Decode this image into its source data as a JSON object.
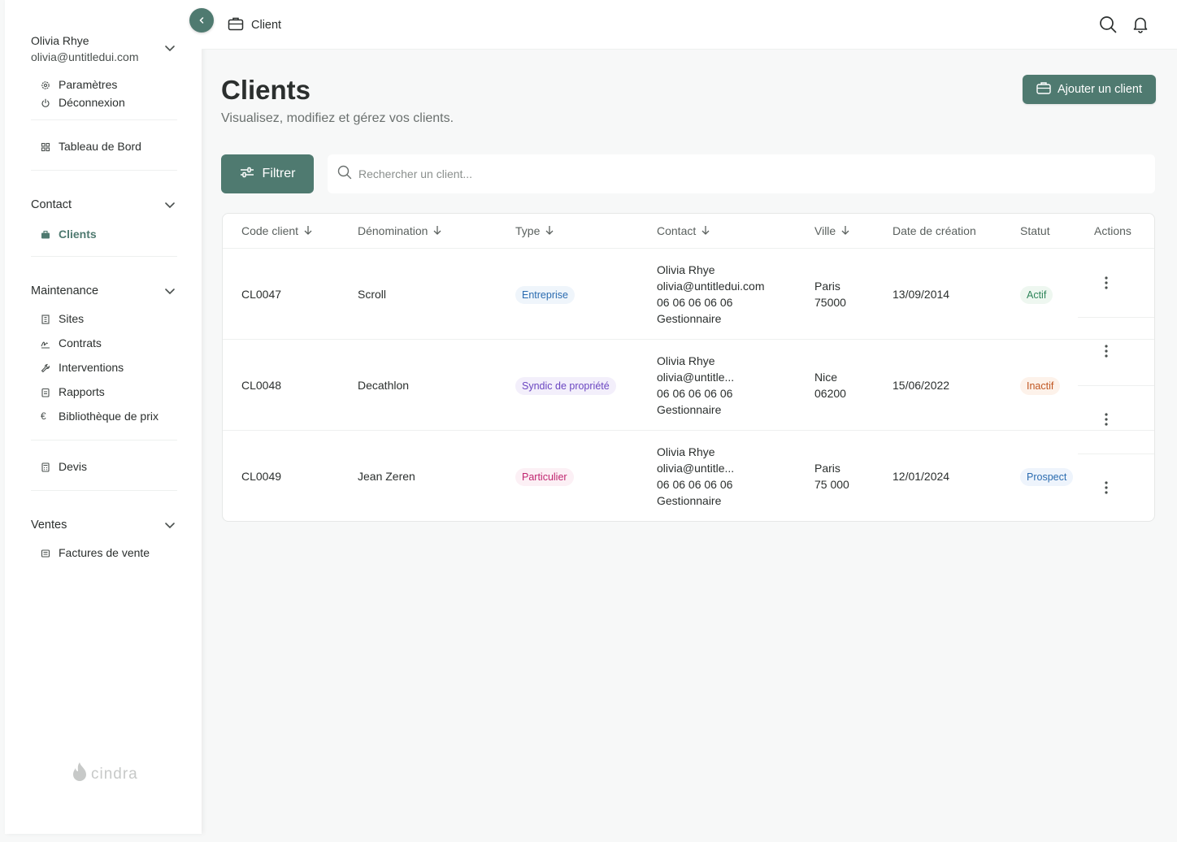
{
  "user": {
    "name": "Olivia Rhye",
    "email": "olivia@untitledui.com"
  },
  "user_menu": [
    {
      "label": "Paramètres",
      "icon": "gear-icon"
    },
    {
      "label": "Déconnexion",
      "icon": "power-icon"
    }
  ],
  "dashboard": {
    "label": "Tableau de Bord",
    "icon": "grid-icon"
  },
  "sections": {
    "contact": {
      "title": "Contact",
      "items": [
        {
          "label": "Clients",
          "icon": "briefcase-icon",
          "active": true
        }
      ]
    },
    "maintenance": {
      "title": "Maintenance",
      "items": [
        {
          "label": "Sites",
          "icon": "building-icon"
        },
        {
          "label": "Contrats",
          "icon": "signature-icon"
        },
        {
          "label": "Interventions",
          "icon": "wrench-icon"
        },
        {
          "label": "Rapports",
          "icon": "clipboard-icon"
        },
        {
          "label": "Bibliothèque de prix",
          "icon": "euro-icon"
        }
      ]
    },
    "devis": {
      "label": "Devis",
      "icon": "calculator-icon"
    },
    "ventes": {
      "title": "Ventes",
      "items": [
        {
          "label": "Factures de vente",
          "icon": "invoice-icon"
        }
      ]
    }
  },
  "logo_text": "cindra",
  "breadcrumb": {
    "label": "Client"
  },
  "page": {
    "title": "Clients",
    "subtitle": "Visualisez, modifiez et gérez vos clients.",
    "add_label": "Ajouter un client",
    "filter_label": "Filtrer",
    "search_placeholder": "Rechercher un client..."
  },
  "table": {
    "columns": [
      "Code client",
      "Dénomination",
      "Type",
      "Contact",
      "Ville",
      "Date de création",
      "Statut",
      "Actions"
    ],
    "rows": [
      {
        "code": "CL0047",
        "name": "Scroll",
        "type": "Entreprise",
        "contact": [
          "Olivia Rhye",
          "olivia@untitledui.com",
          "06 06 06 06 06",
          "Gestionnaire"
        ],
        "city": [
          "Paris",
          "75000"
        ],
        "date": "13/09/2014",
        "status": "Actif"
      },
      {
        "code": "CL0048",
        "name": "Decathlon",
        "type": "Syndic de propriété",
        "contact": [
          "Olivia Rhye",
          "olivia@untitle...",
          "06 06 06 06 06",
          "Gestionnaire"
        ],
        "city": [
          "Nice",
          "06200"
        ],
        "date": "15/06/2022",
        "status": "Inactif"
      },
      {
        "code": "CL0049",
        "name": "Jean Zeren",
        "type": "Particulier",
        "contact": [
          "Olivia Rhye",
          "olivia@untitle...",
          "06 06 06 06 06",
          "Gestionnaire"
        ],
        "city": [
          "Paris",
          "75 000"
        ],
        "date": "12/01/2024",
        "status": "Prospect"
      }
    ]
  },
  "colors": {
    "accent": "#4f7a70"
  }
}
